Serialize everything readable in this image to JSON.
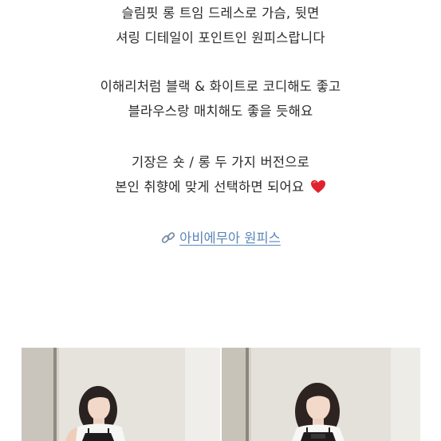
{
  "post": {
    "paragraph1": {
      "line1": "슬림핏 롱 트임 드레스로 가슴, 뒷면",
      "line2": "셔링 디테일이 포인트인 원피스랍니다"
    },
    "paragraph2": {
      "line1": "이해리처럼 블랙 & 화이트로 코디해도 좋고",
      "line2": "블라우스랑 매치해도 좋을 듯해요"
    },
    "paragraph3": {
      "line1": "기장은 숏 / 롱 두 가지 버전으로",
      "line2": "본인 취향에 맞게 선택하면 되어요"
    },
    "heart_icon": "red-heart-emoji",
    "link": {
      "icon": "link-icon",
      "label": "아비에무아 원피스"
    }
  },
  "photos": [
    {
      "name": "photo-1"
    },
    {
      "name": "photo-2"
    }
  ],
  "colors": {
    "text": "#2b2b2b",
    "link": "#5b86b8",
    "heart": "#e0222e",
    "background": "#ffffff"
  }
}
